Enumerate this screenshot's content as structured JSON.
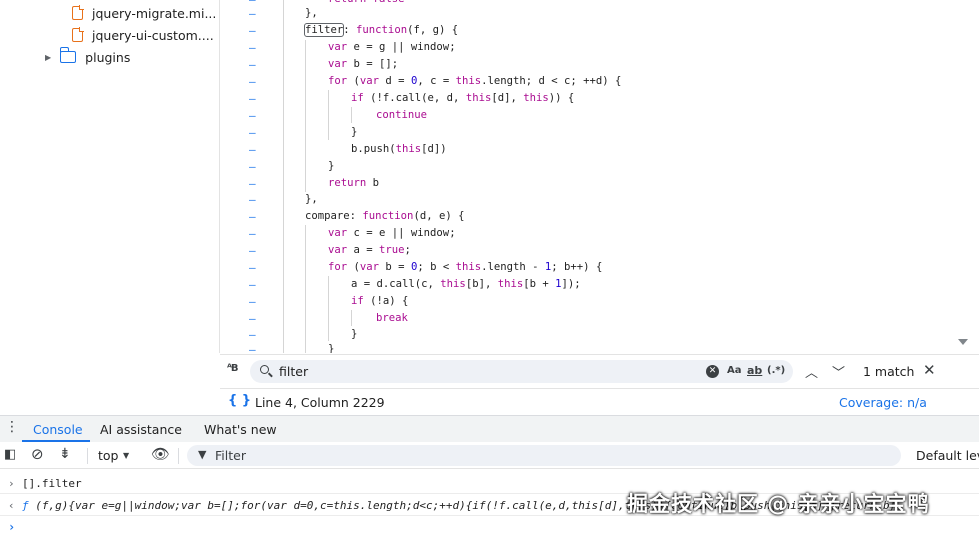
{
  "file_tree": {
    "items": [
      {
        "label": "jquery-migrate.mi...",
        "icon": "js-file-icon"
      },
      {
        "label": "jquery-ui-custom....",
        "icon": "js-file-icon"
      },
      {
        "label": "plugins",
        "icon": "folder-icon"
      }
    ]
  },
  "code": {
    "gutter_mark": "–",
    "lines": [
      "return false",
      "},",
      "filter: function(f, g) {",
      "var e = g || window;",
      "var b = [];",
      "for (var d = 0, c = this.length; d < c; ++d) {",
      "if (!f.call(e, d, this[d], this)) {",
      "continue",
      "}",
      "b.push(this[d])",
      "}",
      "return b",
      "},",
      "compare: function(d, e) {",
      "var c = e || window;",
      "var a = true;",
      "for (var b = 0; b < this.length - 1; b++) {",
      "a = d.call(c, this[b], this[b + 1]);",
      "if (!a) {",
      "break",
      "}",
      "}"
    ]
  },
  "search": {
    "query": "filter",
    "match_case": "Aa",
    "whole_word": "ab",
    "regex": "(.*)",
    "match_count": "1 match"
  },
  "status": {
    "position": "Line 4, Column 2229",
    "coverage": "Coverage: n/a"
  },
  "drawer": {
    "tabs": [
      "Console",
      "AI assistance",
      "What's new"
    ]
  },
  "console_toolbar": {
    "context": "top",
    "filter_placeholder": "Filter",
    "levels": "Default levels"
  },
  "console": {
    "input": "[].filter",
    "output_prefix": "ƒ",
    "output": "(f,g){var e=g||window;var b=[];for(var d=0,c=this.length;d<c;++d){if(!f.call(e,d,this[d],this)){continue}b.push(this[d])}return b}"
  },
  "watermark": "掘金技术社区 @ 亲亲小宝宝鸭"
}
